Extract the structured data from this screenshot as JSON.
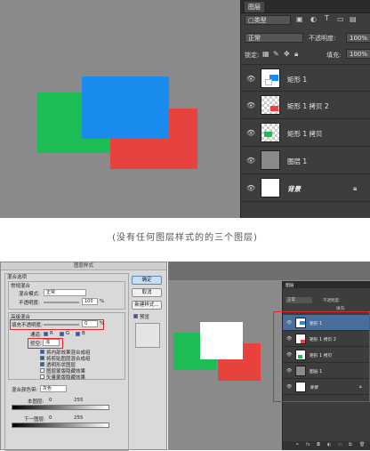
{
  "top": {
    "panel": {
      "tab": "图层",
      "kind": "▢类型",
      "blend": "正常",
      "opacity_label": "不透明度:",
      "opacity_value": "100%",
      "lock_label": "锁定:",
      "fill_label": "填充:",
      "fill_value": "100%",
      "layers": [
        {
          "name": "矩形 1",
          "selected": false
        },
        {
          "name": "矩形 1 拷贝 2",
          "selected": false
        },
        {
          "name": "矩形 1 拷贝",
          "selected": false
        },
        {
          "name": "图层 1",
          "selected": false
        },
        {
          "name": "背景",
          "selected": false
        }
      ]
    },
    "colors": {
      "green": "#1dbd55",
      "blue": "#1a8cf0",
      "red": "#e8423f"
    }
  },
  "caption": "(没有任何图层样式的的三个图层)",
  "dialog": {
    "title": "图层样式",
    "blend_options": "混合选项",
    "normal_blend": "常规混合",
    "blend_mode_label": "混合模式:",
    "blend_mode_value": "正常",
    "opacity_label": "不透明度:",
    "opacity_value": "100",
    "pct": "%",
    "advanced": "高级混合",
    "fill_opacity_label": "填充不透明度:",
    "fill_opacity_value": "0",
    "channels_label": "通道:",
    "channel_r": "R",
    "channel_g": "G",
    "channel_b": "B",
    "knockout_label": "挖空:",
    "knockout_value": "浅",
    "options": [
      "将内部效果混合成组",
      "将剪贴图层混合成组",
      "透明形状图层",
      "图层蒙版隐藏效果",
      "矢量蒙版隐藏效果"
    ],
    "blend_if_label": "混合颜色带:",
    "blend_if_value": "灰色",
    "this_layer": "本图层:",
    "under_layer": "下一图层:",
    "val0": "0",
    "val255": "255",
    "ok": "确定",
    "cancel": "取消",
    "new_style": "新建样式...",
    "preview": "预览"
  },
  "mini": {
    "tab": "图层",
    "blend": "正常",
    "opacity": "不透明度:",
    "fill": "填充:",
    "layers": [
      {
        "name": "矩形 1"
      },
      {
        "name": "矩形 1 拷贝 2"
      },
      {
        "name": "矩形 1 拷贝"
      },
      {
        "name": "图层 1"
      },
      {
        "name": "背景"
      }
    ]
  }
}
